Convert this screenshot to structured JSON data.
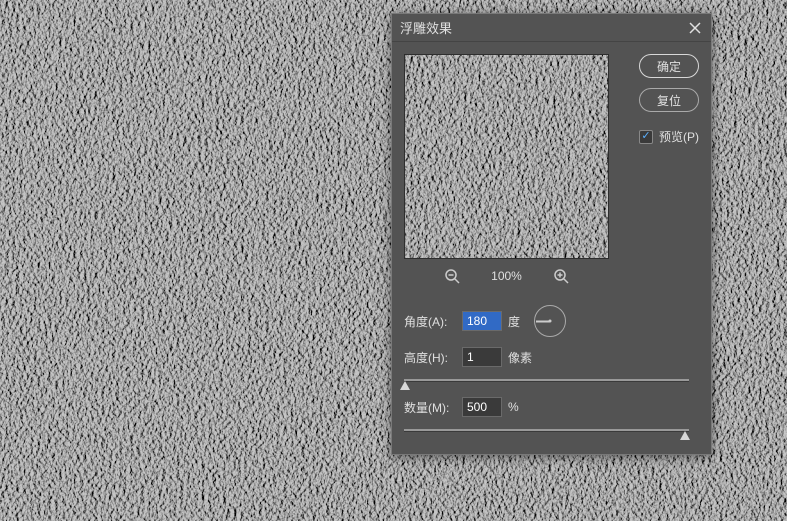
{
  "dialog": {
    "title": "浮雕效果",
    "ok_label": "确定",
    "reset_label": "复位",
    "preview_label": "预览(P)",
    "preview_checked": true,
    "zoom_label": "100%",
    "angle": {
      "label": "角度(A):",
      "value": "180",
      "unit": "度"
    },
    "height": {
      "label": "高度(H):",
      "value": "1",
      "unit": "像素",
      "slider_min": 1,
      "slider_max": 100
    },
    "amount": {
      "label": "数量(M):",
      "value": "500",
      "unit": "%",
      "slider_min": 1,
      "slider_max": 500
    }
  }
}
